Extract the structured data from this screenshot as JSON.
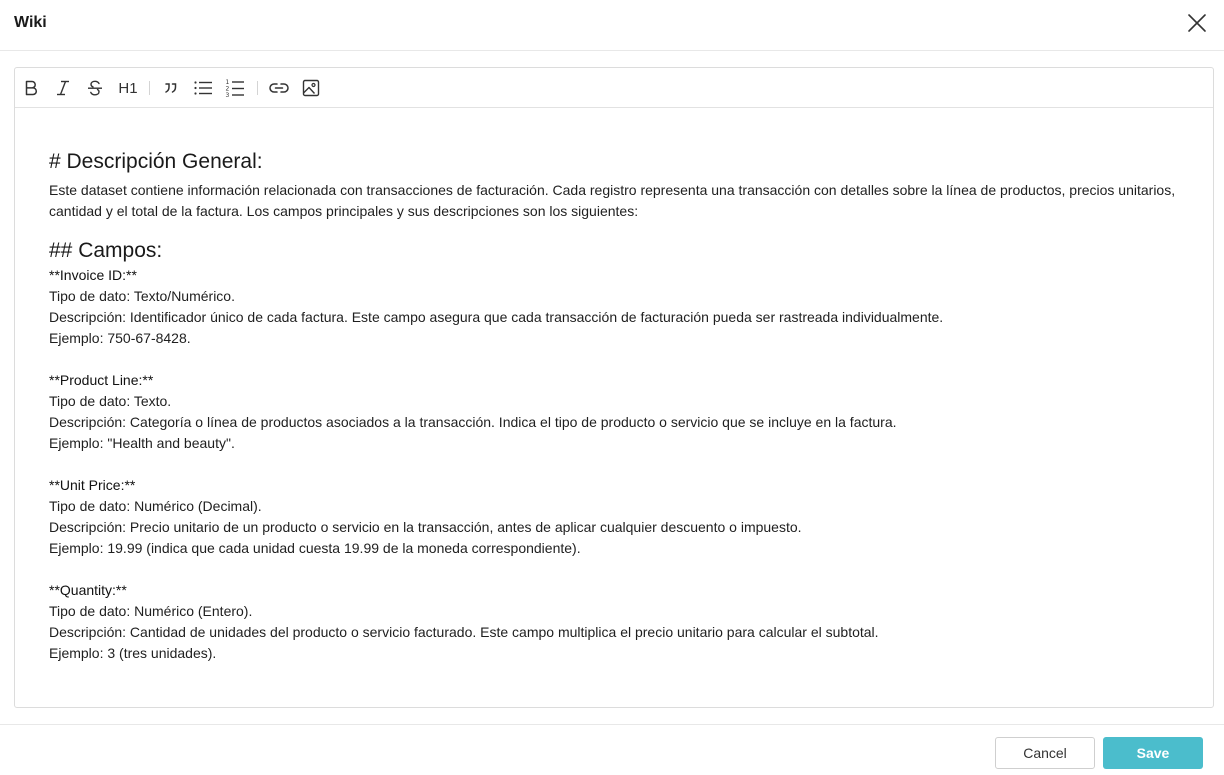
{
  "dialog": {
    "title": "Wiki"
  },
  "toolbar": {
    "buttons": [
      {
        "icon": "bold-icon"
      },
      {
        "icon": "italic-icon"
      },
      {
        "icon": "strikethrough-icon"
      },
      {
        "icon": "heading-icon",
        "label": "H1"
      },
      {
        "icon": "quote-icon"
      },
      {
        "icon": "bulleted-list-icon"
      },
      {
        "icon": "numbered-list-icon"
      },
      {
        "icon": "link-icon"
      },
      {
        "icon": "image-icon"
      }
    ]
  },
  "content": {
    "heading1": "# Descripción General:",
    "intro": "Este dataset contiene información relacionada con transacciones de facturación. Cada registro representa una transacción con detalles sobre la línea de productos, precios unitarios, cantidad y el total de la factura. Los campos principales y sus descripciones son los siguientes:",
    "heading2": "## Campos:",
    "fields": [
      {
        "name": "**Invoice ID:**",
        "type": "Tipo de dato: Texto/Numérico.",
        "description": "Descripción: Identificador único de cada factura. Este campo asegura que cada transacción de facturación pueda ser rastreada individualmente.",
        "example": "Ejemplo: 750-67-8428."
      },
      {
        "name": "**Product Line:**",
        "type": "Tipo de dato: Texto.",
        "description": "Descripción: Categoría o línea de productos asociados a la transacción. Indica el tipo de producto o servicio que se incluye en la factura.",
        "example": "Ejemplo: \"Health and beauty\"."
      },
      {
        "name": "**Unit Price:**",
        "type": "Tipo de dato: Numérico (Decimal).",
        "description": "Descripción: Precio unitario de un producto o servicio en la transacción, antes de aplicar cualquier descuento o impuesto.",
        "example": "Ejemplo: 19.99 (indica que cada unidad cuesta 19.99 de la moneda correspondiente)."
      },
      {
        "name": "**Quantity:**",
        "type": "Tipo de dato: Numérico (Entero).",
        "description": "Descripción: Cantidad de unidades del producto o servicio facturado. Este campo multiplica el precio unitario para calcular el subtotal.",
        "example": "Ejemplo: 3 (tres unidades)."
      }
    ]
  },
  "footer": {
    "cancel_label": "Cancel",
    "save_label": "Save"
  },
  "colors": {
    "save_button": "#4bbdcc",
    "border": "#dcdcdc"
  }
}
